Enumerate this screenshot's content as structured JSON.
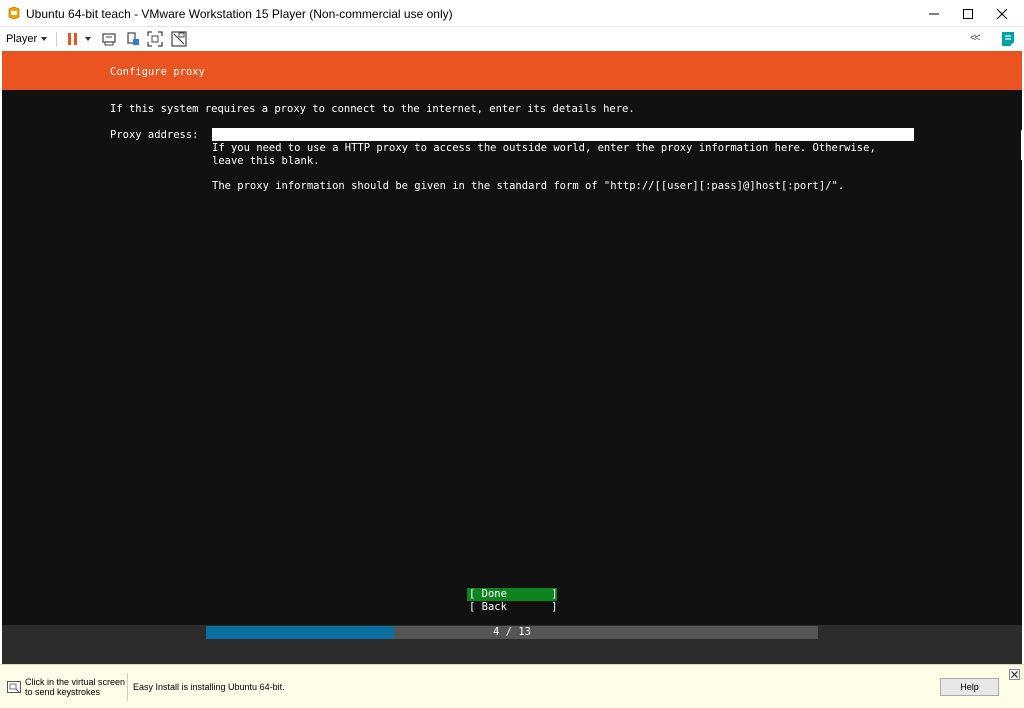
{
  "window": {
    "title": "Ubuntu 64-bit teach - VMware Workstation 15 Player (Non-commercial use only)"
  },
  "toolbar": {
    "player_label": "Player",
    "back_label": "<<"
  },
  "installer": {
    "header_title": "Configure proxy",
    "intro": "If this system requires a proxy to connect to the internet, enter its details here.",
    "proxy_label": "Proxy address:",
    "proxy_value": "",
    "help_line1": "If you need to use a HTTP proxy to access the outside world, enter the proxy information here. Otherwise,",
    "help_line2": "leave this blank.",
    "help_line3": "The proxy information should be given in the standard form of \"http://[[user][:pass]@]host[:port]/\".",
    "done_label": "[ Done       ]",
    "back_label": "[ Back       ]",
    "progress_text": "4 / 13",
    "progress_step": 4,
    "progress_total": 13,
    "progress_fraction": 0.3077
  },
  "statusbar": {
    "hint_line1": "Click in the virtual screen",
    "hint_line2": "to send keystrokes",
    "message": "Easy Install is installing Ubuntu 64-bit.",
    "help_label": "Help"
  },
  "colors": {
    "header": "#e95420",
    "console_bg": "#111111",
    "done_bg": "#0e8420",
    "progress_fill": "#0a6e9e",
    "status_bg": "#fdfde8"
  }
}
